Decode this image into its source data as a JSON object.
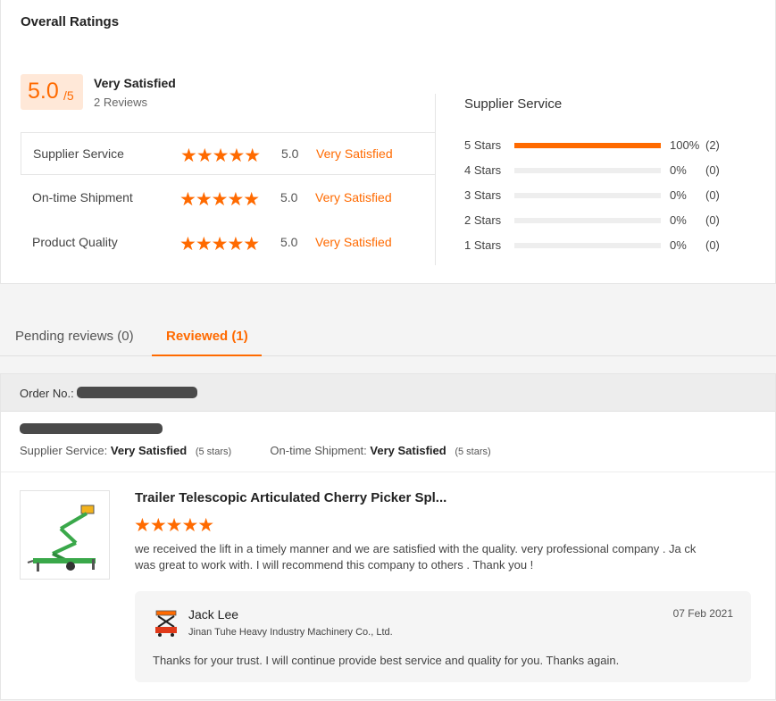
{
  "overall": {
    "title": "Overall Ratings",
    "score": "5.0",
    "score_max": "/5",
    "label": "Very Satisfied",
    "reviews": "2 Reviews"
  },
  "ratings": [
    {
      "name": "Supplier Service",
      "stars": "★★★★★",
      "value": "5.0",
      "text": "Very Satisfied"
    },
    {
      "name": "On-time Shipment",
      "stars": "★★★★★",
      "value": "5.0",
      "text": "Very Satisfied"
    },
    {
      "name": "Product Quality",
      "stars": "★★★★★",
      "value": "5.0",
      "text": "Very Satisfied"
    }
  ],
  "distribution": {
    "title": "Supplier Service",
    "rows": [
      {
        "label": "5  Stars",
        "percent": "100%",
        "count": "(2)",
        "fraction": 1.0
      },
      {
        "label": "4  Stars",
        "percent": "0%",
        "count": "(0)",
        "fraction": 0
      },
      {
        "label": "3  Stars",
        "percent": "0%",
        "count": "(0)",
        "fraction": 0
      },
      {
        "label": "2  Stars",
        "percent": "0%",
        "count": "(0)",
        "fraction": 0
      },
      {
        "label": "1  Stars",
        "percent": "0%",
        "count": "(0)",
        "fraction": 0
      }
    ]
  },
  "tabs": [
    {
      "label": "Pending reviews (0)",
      "active": false
    },
    {
      "label": "Reviewed (1)",
      "active": true
    }
  ],
  "review": {
    "order_label": "Order No.:",
    "supplier_service_label": "Supplier Service:",
    "supplier_service_value": "Very Satisfied",
    "supplier_service_stars": "(5 stars)",
    "shipment_label": "On-time Shipment:",
    "shipment_value": "Very Satisfied",
    "shipment_stars": "(5 stars)",
    "product_title": "Trailer Telescopic Articulated Cherry Picker Spl...",
    "product_stars": "★★★★★",
    "text": "we received the lift in a timely manner and we are satisfied with the quality. very professional company . Ja ck was great to work with. I will recommend this company to others . Thank you !",
    "reply": {
      "name": "Jack Lee",
      "company": "Jinan Tuhe Heavy Industry Machinery Co., Ltd.",
      "date": "07 Feb 2021",
      "text": "Thanks for your trust. I will continue provide best service and quality for you. Thanks again."
    }
  },
  "colors": {
    "accent": "#ff6a00",
    "score_bg": "#ffe8d8",
    "product_green": "#3aa84a"
  }
}
